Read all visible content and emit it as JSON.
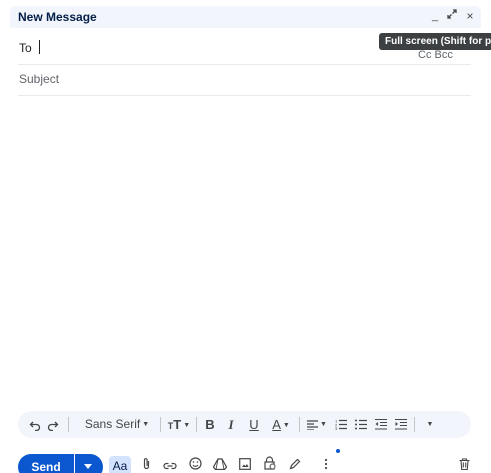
{
  "window": {
    "title": "New Message",
    "minimize_symbol": "_",
    "fullscreen_symbol": "⤢",
    "close_symbol": "×",
    "tooltip": "Full screen (Shift for pop-out)"
  },
  "compose": {
    "to_label": "To",
    "cc_bcc_label": "Cc Bcc",
    "subject_placeholder": "Subject"
  },
  "format_toolbar": {
    "undo_icon": "undo-icon",
    "redo_icon": "redo-icon",
    "font_family": "Sans Serif",
    "font_size_icon": "text-size-icon",
    "bold": "B",
    "italic": "I",
    "underline": "U",
    "text_color": "A",
    "align_icon": "align-icon",
    "numbered_list_icon": "numbered-list-icon",
    "bulleted_list_icon": "bulleted-list-icon",
    "indent_less_icon": "indent-less-icon",
    "indent_more_icon": "indent-more-icon",
    "more_formatting_icon": "chevron-down-icon"
  },
  "bottom_bar": {
    "send_label": "Send",
    "formatting_label": "Aa",
    "icons": [
      "attach-icon",
      "link-icon",
      "emoji-icon",
      "drive-icon",
      "photo-icon",
      "lock-clock-icon",
      "signature-icon",
      "more-options-icon",
      "trash-icon"
    ]
  },
  "colors": {
    "accent": "#0b57d0",
    "header_bg": "#f2f6fc",
    "title_text": "#041e49",
    "tooltip_bg": "#3c4043"
  }
}
